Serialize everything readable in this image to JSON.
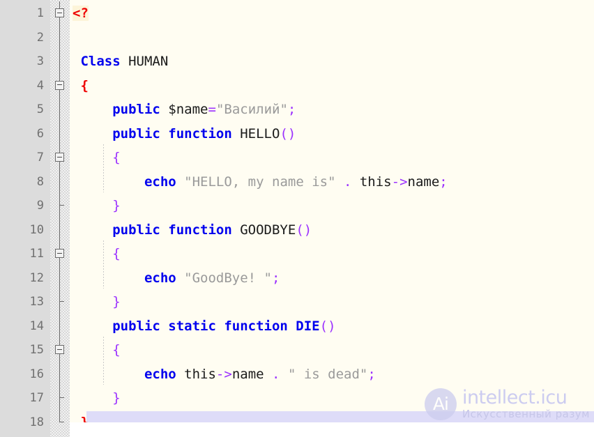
{
  "editor": {
    "language": "PHP",
    "background_color": "#fffdf2",
    "gutter_color": "#dcdcdc",
    "selection_color": "#dedcf8",
    "colors": {
      "keyword": "#0000ee",
      "string": "#9a9a9a",
      "punctuation": "#9b30ff",
      "php_tag": "#ee0000",
      "plain": "#1a1a1a",
      "linenumber": "#707070"
    },
    "line_numbers": [
      "1",
      "2",
      "3",
      "4",
      "5",
      "6",
      "7",
      "8",
      "9",
      "10",
      "11",
      "12",
      "13",
      "14",
      "15",
      "16",
      "17",
      "18"
    ],
    "lines": [
      {
        "number": "1",
        "fold": "box",
        "text": "<?",
        "tokens": [
          {
            "t": "<?",
            "k": "tag"
          }
        ]
      },
      {
        "number": "2",
        "fold": "line",
        "text": "",
        "tokens": []
      },
      {
        "number": "3",
        "fold": "line",
        "text": " Class HUMAN",
        "tokens": [
          {
            "t": " ",
            "k": "plain"
          },
          {
            "t": "Class",
            "k": "kw"
          },
          {
            "t": " HUMAN",
            "k": "plain"
          }
        ]
      },
      {
        "number": "4",
        "fold": "box",
        "text": " {",
        "tokens": [
          {
            "t": " ",
            "k": "plain"
          },
          {
            "t": "{",
            "k": "redbrace"
          }
        ]
      },
      {
        "number": "5",
        "fold": "line",
        "text": "     public $name=\"Василий\";",
        "tokens": [
          {
            "t": "     ",
            "k": "plain"
          },
          {
            "t": "public",
            "k": "kw"
          },
          {
            "t": " $name",
            "k": "plain"
          },
          {
            "t": "=",
            "k": "punc"
          },
          {
            "t": "\"Василий\"",
            "k": "str"
          },
          {
            "t": ";",
            "k": "punc"
          }
        ]
      },
      {
        "number": "6",
        "fold": "line",
        "text": "     public function HELLO()",
        "tokens": [
          {
            "t": "     ",
            "k": "plain"
          },
          {
            "t": "public function",
            "k": "kw"
          },
          {
            "t": " HELLO",
            "k": "plain"
          },
          {
            "t": "()",
            "k": "punc"
          }
        ]
      },
      {
        "number": "7",
        "fold": "box",
        "text": "     {",
        "tokens": [
          {
            "t": "     ",
            "k": "plain"
          },
          {
            "t": "{",
            "k": "brace"
          }
        ]
      },
      {
        "number": "8",
        "fold": "line",
        "text": "         echo \"HELLO, my name is\" . this->name;",
        "tokens": [
          {
            "t": "         ",
            "k": "plain"
          },
          {
            "t": "echo",
            "k": "kw"
          },
          {
            "t": " ",
            "k": "plain"
          },
          {
            "t": "\"HELLO, my name is\"",
            "k": "str"
          },
          {
            "t": " ",
            "k": "plain"
          },
          {
            "t": ".",
            "k": "punc"
          },
          {
            "t": " this",
            "k": "plain"
          },
          {
            "t": "->",
            "k": "punc"
          },
          {
            "t": "name",
            "k": "plain"
          },
          {
            "t": ";",
            "k": "punc"
          }
        ]
      },
      {
        "number": "9",
        "fold": "endtick",
        "text": "     }",
        "tokens": [
          {
            "t": "     ",
            "k": "plain"
          },
          {
            "t": "}",
            "k": "brace"
          }
        ]
      },
      {
        "number": "10",
        "fold": "line",
        "text": "     public function GOODBYE()",
        "tokens": [
          {
            "t": "     ",
            "k": "plain"
          },
          {
            "t": "public function",
            "k": "kw"
          },
          {
            "t": " GOODBYE",
            "k": "plain"
          },
          {
            "t": "()",
            "k": "punc"
          }
        ]
      },
      {
        "number": "11",
        "fold": "box",
        "text": "     {",
        "tokens": [
          {
            "t": "     ",
            "k": "plain"
          },
          {
            "t": "{",
            "k": "brace"
          }
        ]
      },
      {
        "number": "12",
        "fold": "line",
        "text": "         echo \"GoodBye! \";",
        "tokens": [
          {
            "t": "         ",
            "k": "plain"
          },
          {
            "t": "echo",
            "k": "kw"
          },
          {
            "t": " ",
            "k": "plain"
          },
          {
            "t": "\"GoodBye! \"",
            "k": "str"
          },
          {
            "t": ";",
            "k": "punc"
          }
        ]
      },
      {
        "number": "13",
        "fold": "endtick",
        "text": "     }",
        "tokens": [
          {
            "t": "     ",
            "k": "plain"
          },
          {
            "t": "}",
            "k": "brace"
          }
        ]
      },
      {
        "number": "14",
        "fold": "line",
        "text": "     public static function DIE()",
        "tokens": [
          {
            "t": "     ",
            "k": "plain"
          },
          {
            "t": "public static function DIE",
            "k": "kw"
          },
          {
            "t": "()",
            "k": "punc"
          }
        ]
      },
      {
        "number": "15",
        "fold": "box",
        "text": "     {",
        "tokens": [
          {
            "t": "     ",
            "k": "plain"
          },
          {
            "t": "{",
            "k": "brace"
          }
        ]
      },
      {
        "number": "16",
        "fold": "line",
        "text": "         echo this->name . \" is dead\";",
        "tokens": [
          {
            "t": "         ",
            "k": "plain"
          },
          {
            "t": "echo",
            "k": "kw"
          },
          {
            "t": " this",
            "k": "plain"
          },
          {
            "t": "->",
            "k": "punc"
          },
          {
            "t": "name",
            "k": "plain"
          },
          {
            "t": " ",
            "k": "plain"
          },
          {
            "t": ".",
            "k": "punc"
          },
          {
            "t": " ",
            "k": "plain"
          },
          {
            "t": "\" is dead\"",
            "k": "str"
          },
          {
            "t": ";",
            "k": "punc"
          }
        ]
      },
      {
        "number": "17",
        "fold": "endtick",
        "text": "     }",
        "tokens": [
          {
            "t": "     ",
            "k": "plain"
          },
          {
            "t": "}",
            "k": "brace"
          }
        ]
      },
      {
        "number": "18",
        "fold": "endcorner",
        "selected": true,
        "text": " }",
        "tokens": [
          {
            "t": " ",
            "k": "plain"
          },
          {
            "t": "}",
            "k": "redbrace"
          }
        ]
      }
    ]
  },
  "watermark": {
    "logo_text": "Ai",
    "title": "intellect.icu",
    "subtitle": "Искусственный разум"
  }
}
